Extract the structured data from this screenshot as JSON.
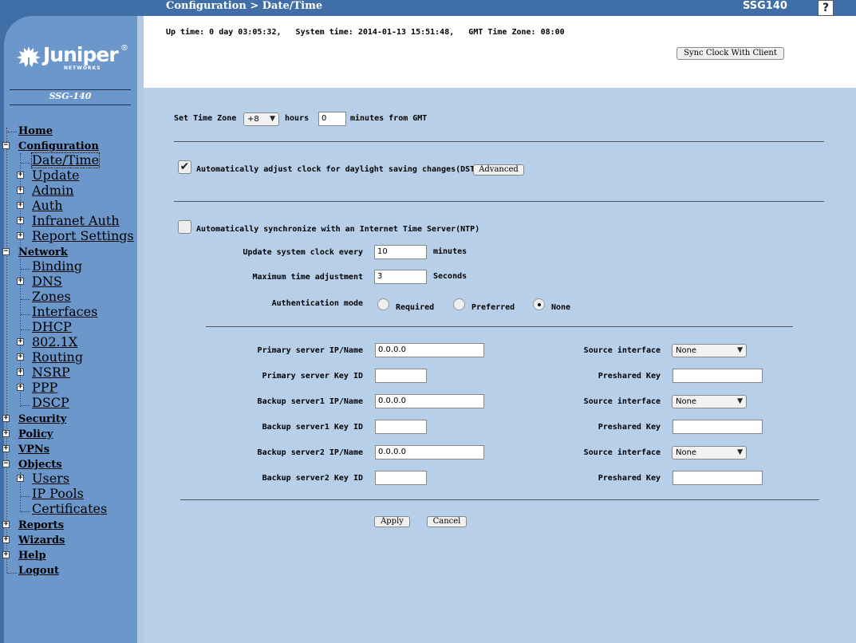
{
  "header": {
    "title": "Configuration > Date/Time",
    "device": "SSG140",
    "help": "?"
  },
  "status": {
    "line": "Up time: 0 day 03:05:32,   System time: 2014-01-13 15:51:48,   GMT Time Zone: 08:00"
  },
  "sync_button": "Sync Clock With Client",
  "sidebar": {
    "logo_text": "Juniper",
    "logo_sub": "NETWORKS",
    "logo_reg": "®",
    "device_label": "SSG-140",
    "items": {
      "home": "Home",
      "configuration": "Configuration",
      "datetime": "Date/Time",
      "update": "Update",
      "admin": "Admin",
      "auth": "Auth",
      "infranet_auth": "Infranet Auth",
      "report_settings": "Report Settings",
      "network": "Network",
      "binding": "Binding",
      "dns": "DNS",
      "zones": "Zones",
      "interfaces": "Interfaces",
      "dhcp": "DHCP",
      "dot1x": "802.1X",
      "routing": "Routing",
      "nsrp": "NSRP",
      "ppp": "PPP",
      "dscp": "DSCP",
      "security": "Security",
      "policy": "Policy",
      "vpns": "VPNs",
      "objects": "Objects",
      "users": "Users",
      "ip_pools": "IP Pools",
      "certificates": "Certificates",
      "reports": "Reports",
      "wizards": "Wizards",
      "help": "Help",
      "logout": "Logout"
    },
    "plus": "+",
    "minus": "−"
  },
  "form": {
    "timezone": {
      "label": "Set Time Zone",
      "hours_value": "+8",
      "hours_label": "hours",
      "minutes_value": "0",
      "minutes_label": "minutes  from GMT"
    },
    "dst": {
      "checked_mark": "✔",
      "label": "Automatically adjust clock for daylight saving changes(DST)",
      "advanced_button": "Advanced"
    },
    "ntp": {
      "label": "Automatically synchronize with an Internet Time Server(NTP)",
      "update_label": "Update system clock every",
      "update_value": "10",
      "update_unit": "minutes",
      "max_adj_label": "Maximum time adjustment",
      "max_adj_value": "3",
      "max_adj_unit": "Seconds",
      "auth_label": "Authentication mode",
      "auth_options": [
        "Required",
        "Preferred",
        "None"
      ],
      "auth_selected": "None"
    },
    "servers": {
      "primary_ip_label": "Primary server IP/Name",
      "primary_ip_value": "0.0.0.0",
      "primary_key_label": "Primary server Key ID",
      "backup1_ip_label": "Backup server1 IP/Name",
      "backup1_ip_value": "0.0.0.0",
      "backup1_key_label": "Backup server1 Key ID",
      "backup2_ip_label": "Backup server2 IP/Name",
      "backup2_ip_value": "0.0.0.0",
      "backup2_key_label": "Backup server2 Key ID",
      "source_interface_label": "Source interface",
      "source_interface_value": "None",
      "preshared_key_label": "Preshared Key"
    },
    "apply_button": "Apply",
    "cancel_button": "Cancel"
  }
}
